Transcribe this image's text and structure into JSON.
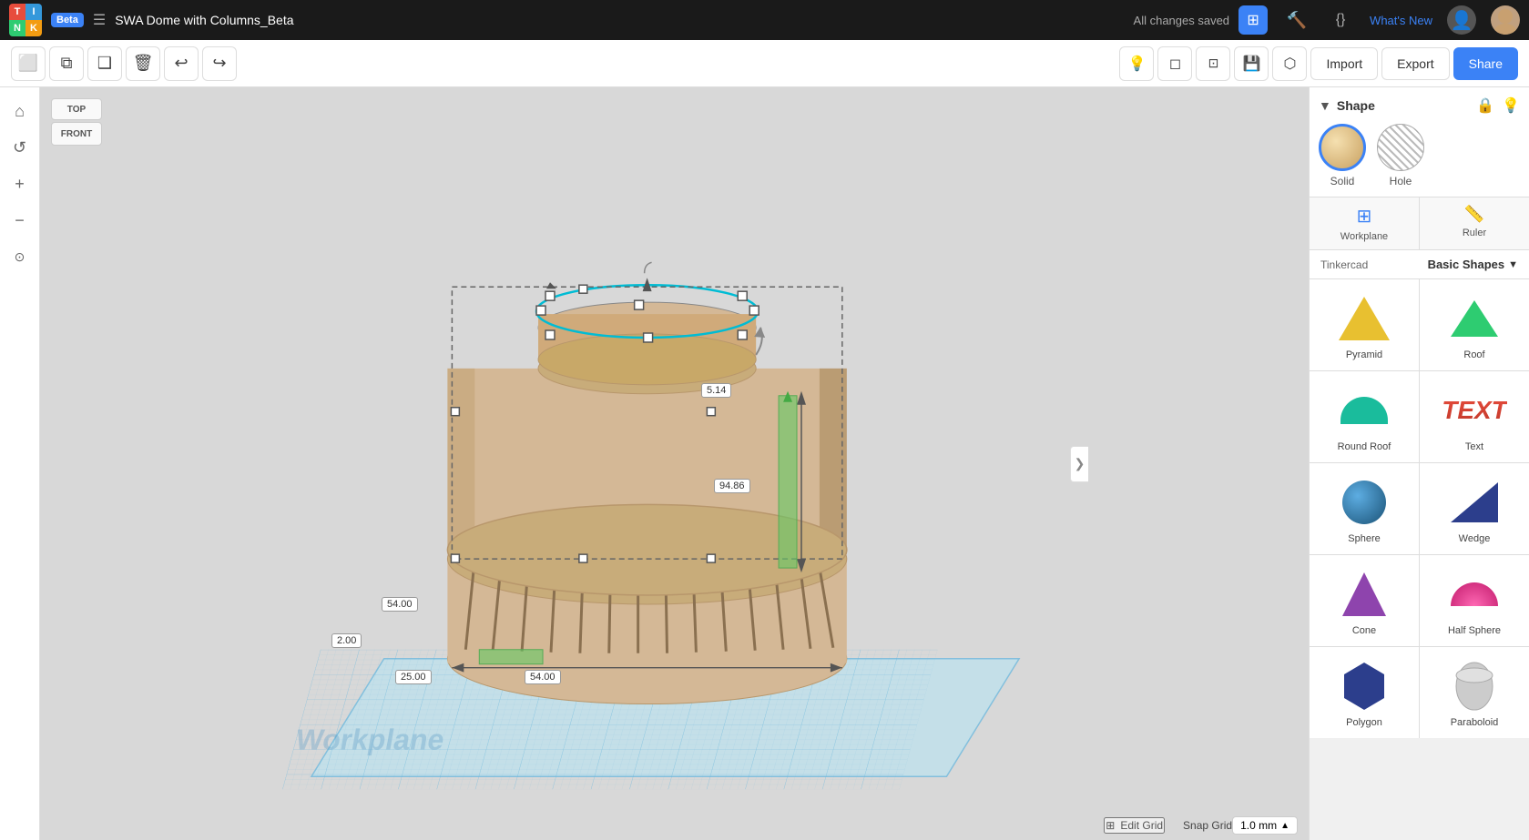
{
  "app": {
    "logo_letters": [
      "T",
      "I",
      "N",
      "K"
    ],
    "beta_label": "Beta",
    "doc_title": "SWA Dome with Columns_Beta",
    "save_status": "All changes saved"
  },
  "topbar": {
    "whats_new": "What's New",
    "import_label": "Import",
    "export_label": "Export",
    "share_label": "Share"
  },
  "toolbar": {
    "copy_icon": "⧉",
    "duplicate_icon": "❏",
    "group_icon": "⊞",
    "delete_icon": "🗑",
    "undo_icon": "↩",
    "redo_icon": "↪",
    "light_icon": "💡",
    "hide_icon": "◻",
    "hide2_icon": "◻",
    "save_icon": "💾",
    "mirror_icon": "⬡"
  },
  "left_nav": {
    "home_icon": "⌂",
    "rotate_icon": "↺",
    "zoom_in_icon": "+",
    "zoom_out_icon": "−",
    "fit_icon": "⊙"
  },
  "view_cube": {
    "top_label": "TOP",
    "front_label": "FRONT"
  },
  "shape_panel": {
    "title": "Shape",
    "solid_label": "Solid",
    "hole_label": "Hole"
  },
  "workplane_ruler": {
    "workplane_label": "Workplane",
    "ruler_label": "Ruler"
  },
  "library": {
    "tinkercad_label": "Tinkercad",
    "basic_shapes_label": "Basic Shapes"
  },
  "shapes": [
    {
      "id": "pyramid",
      "label": "Pyramid",
      "type": "pyramid"
    },
    {
      "id": "roof",
      "label": "Roof",
      "type": "roof"
    },
    {
      "id": "round-roof",
      "label": "Round Roof",
      "type": "round-roof"
    },
    {
      "id": "text",
      "label": "Text",
      "type": "text"
    },
    {
      "id": "sphere",
      "label": "Sphere",
      "type": "sphere"
    },
    {
      "id": "wedge",
      "label": "Wedge",
      "type": "wedge"
    },
    {
      "id": "cone",
      "label": "Cone",
      "type": "cone"
    },
    {
      "id": "half-sphere",
      "label": "Half Sphere",
      "type": "half-sphere"
    },
    {
      "id": "polygon",
      "label": "Polygon",
      "type": "polygon"
    },
    {
      "id": "paraboloid",
      "label": "Paraboloid",
      "type": "paraboloid"
    }
  ],
  "dimensions": {
    "d1": "5.14",
    "d2": "94.86",
    "d3": "54.00",
    "d4": "2.00",
    "d5": "25.00",
    "d6": "54.00"
  },
  "scene": {
    "workplane_text": "Workplane"
  },
  "bottom": {
    "edit_grid_label": "Edit Grid",
    "snap_grid_label": "Snap Grid",
    "snap_grid_value": "1.0 mm"
  }
}
